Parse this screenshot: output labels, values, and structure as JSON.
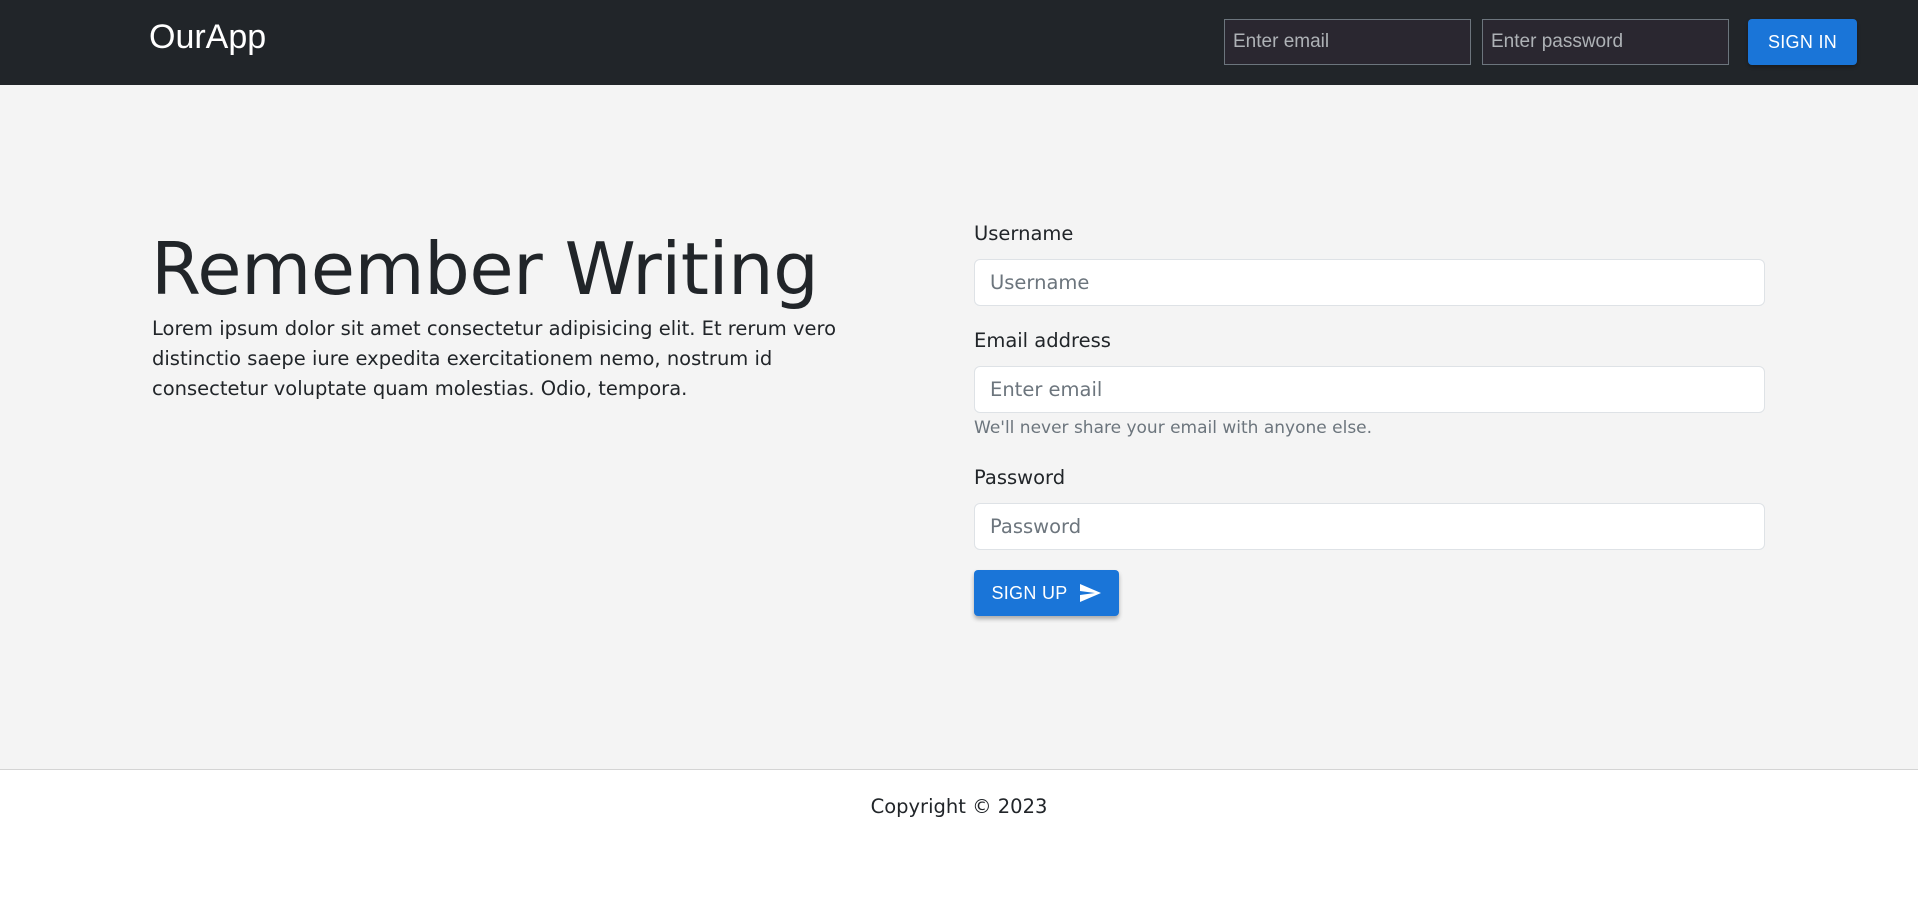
{
  "header": {
    "brand": "OurApp",
    "email_placeholder": "Enter email",
    "password_placeholder": "Enter password",
    "signin_label": "SIGN IN"
  },
  "hero": {
    "title": "Remember Writing",
    "text": "Lorem ipsum dolor sit amet consectetur adipisicing elit. Et rerum vero distinctio saepe iure expedita exercitationem nemo, nostrum id consectetur voluptate quam molestias. Odio, tempora."
  },
  "form": {
    "username_label": "Username",
    "username_placeholder": "Username",
    "email_label": "Email address",
    "email_placeholder": "Enter email",
    "email_help": "We'll never share your email with anyone else.",
    "password_label": "Password",
    "password_placeholder": "Password",
    "signup_label": "SIGN UP",
    "signup_icon": "send-icon"
  },
  "footer": {
    "copyright": "Copyright © 2023"
  },
  "colors": {
    "navbar": "#212529",
    "primary": "#1a75d8",
    "main_bg": "#f4f4f4"
  }
}
